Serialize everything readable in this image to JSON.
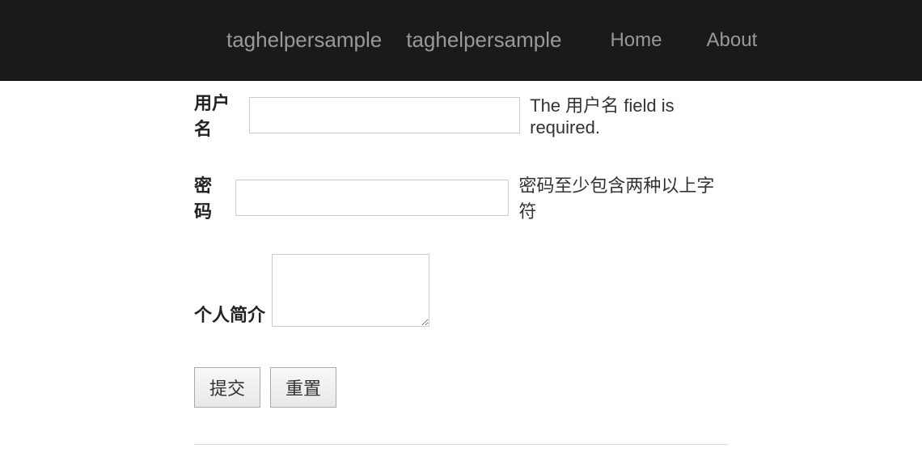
{
  "navbar": {
    "brand1": "taghelpersample",
    "brand2": "taghelpersample",
    "links": {
      "home": "Home",
      "about": "About"
    }
  },
  "form": {
    "username": {
      "label": "用户名",
      "value": "",
      "validation": "The 用户名 field is required."
    },
    "password": {
      "label": "密码",
      "value": "",
      "validation": "密码至少包含两种以上字符"
    },
    "bio": {
      "label": "个人简介",
      "value": ""
    },
    "buttons": {
      "submit": "提交",
      "reset": "重置"
    }
  }
}
